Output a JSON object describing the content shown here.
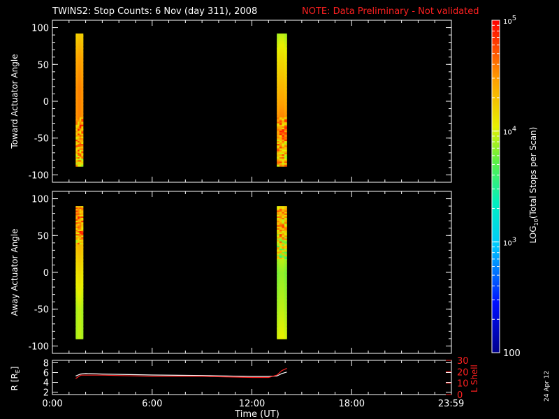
{
  "header": {
    "title": "TWINS2: Stop Counts:  6 Nov (day 311), 2008",
    "note": "NOTE: Data Preliminary - Not validated"
  },
  "footer": {
    "date_stamp": "24 Apr 12"
  },
  "colorbar": {
    "label": "LOG10(Total Stops per Scan)",
    "label_main": "LOG",
    "label_sub": "10",
    "label_rest": "(Total Stops per Scan)",
    "ticks": [
      {
        "value": 100,
        "text": "100"
      },
      {
        "value": 1000,
        "text": "10^3",
        "base": "10",
        "exp": "3"
      },
      {
        "value": 10000,
        "text": "10^4",
        "base": "10",
        "exp": "4"
      },
      {
        "value": 100000,
        "text": "10^5",
        "base": "10",
        "exp": "5"
      }
    ],
    "range": [
      100,
      100000
    ],
    "scale": "log",
    "colormap": "rainbow (blue-cyan-green-yellow-orange-red)"
  },
  "colors": {
    "background": "#000000",
    "axes": "#ffffff",
    "note": "#ff2020",
    "r_line": "#ffffff",
    "l_shell_line": "#ff2020"
  },
  "chart_data": [
    {
      "type": "heatmap",
      "ylabel": "Toward Actuator Angle",
      "xlim": [
        0,
        24
      ],
      "ylim": [
        -110,
        110
      ],
      "yticks": [
        100,
        50,
        0,
        -50,
        -100
      ],
      "yticklabels": [
        "100",
        "50",
        "0",
        "-50",
        "-100"
      ],
      "scan_bands": [
        {
          "start_hour": 1.4,
          "end_hour": 1.85,
          "angle_range": [
            -88,
            92
          ],
          "profile": [
            {
              "angle": 92,
              "log10_counts": 4.2
            },
            {
              "angle": 60,
              "log10_counts": 4.4
            },
            {
              "angle": 20,
              "log10_counts": 4.5
            },
            {
              "angle": 0,
              "log10_counts": 4.5
            },
            {
              "angle": -20,
              "log10_counts": 4.5
            },
            {
              "angle": -50,
              "log10_counts": 4.4,
              "noisy": true
            },
            {
              "angle": -88,
              "log10_counts": 4.3,
              "noisy": true
            }
          ]
        },
        {
          "start_hour": 13.5,
          "end_hour": 14.1,
          "angle_range": [
            -88,
            92
          ],
          "profile": [
            {
              "angle": 92,
              "log10_counts": 3.9
            },
            {
              "angle": 60,
              "log10_counts": 4.1
            },
            {
              "angle": 20,
              "log10_counts": 4.3
            },
            {
              "angle": 0,
              "log10_counts": 4.4
            },
            {
              "angle": -20,
              "log10_counts": 4.5
            },
            {
              "angle": -50,
              "log10_counts": 4.4,
              "noisy": true
            },
            {
              "angle": -88,
              "log10_counts": 4.3,
              "noisy": true
            }
          ]
        }
      ]
    },
    {
      "type": "heatmap",
      "ylabel": "Away Actuator Angle",
      "xlim": [
        0,
        24
      ],
      "ylim": [
        -110,
        110
      ],
      "yticks": [
        100,
        50,
        0,
        -50,
        -100
      ],
      "yticklabels": [
        "100",
        "50",
        "0",
        "-50",
        "-100"
      ],
      "scan_bands": [
        {
          "start_hour": 1.4,
          "end_hour": 1.85,
          "angle_range": [
            -90,
            90
          ],
          "profile": [
            {
              "angle": 90,
              "log10_counts": 4.4,
              "noisy": true
            },
            {
              "angle": 60,
              "log10_counts": 4.5,
              "noisy": true
            },
            {
              "angle": 40,
              "log10_counts": 4.3
            },
            {
              "angle": 0,
              "log10_counts": 4.1
            },
            {
              "angle": -50,
              "log10_counts": 3.9
            },
            {
              "angle": -90,
              "log10_counts": 3.9
            }
          ]
        },
        {
          "start_hour": 13.5,
          "end_hour": 14.1,
          "angle_range": [
            -90,
            90
          ],
          "profile": [
            {
              "angle": 90,
              "log10_counts": 4.4,
              "noisy": true
            },
            {
              "angle": 50,
              "log10_counts": 4.3,
              "noisy": true
            },
            {
              "angle": 20,
              "log10_counts": 3.9
            },
            {
              "angle": 0,
              "log10_counts": 3.8
            },
            {
              "angle": -50,
              "log10_counts": 3.9
            },
            {
              "angle": -90,
              "log10_counts": 4.0
            }
          ]
        }
      ]
    },
    {
      "type": "line",
      "xlabel": "Time (UT)",
      "xlim": [
        0,
        24
      ],
      "xticks": [
        0,
        6,
        12,
        18,
        23.983
      ],
      "xticklabels": [
        "0:00",
        "6:00",
        "12:00",
        "18:00",
        "23:59"
      ],
      "ylabel_left": "R [RE]",
      "ylabel_left_main": "R [R",
      "ylabel_left_sub": "E",
      "ylabel_left_end": "]",
      "ylim_left": [
        1.5,
        8.5
      ],
      "yticks_left": [
        2,
        4,
        6,
        8
      ],
      "ylabel_right": "L Shell",
      "ylim_right": [
        0,
        30
      ],
      "yticks_right": [
        0,
        10,
        20,
        30
      ],
      "series": [
        {
          "axis": "left",
          "x": [
            1.4,
            1.7,
            2.0,
            3.0,
            6.0,
            9.0,
            12.0,
            13.0,
            13.5,
            13.8,
            14.1
          ],
          "y": [
            5.3,
            5.7,
            5.8,
            5.7,
            5.5,
            5.4,
            5.2,
            5.2,
            5.3,
            5.8,
            6.1
          ]
        },
        {
          "axis": "right",
          "x": [
            1.4,
            1.7,
            2.0,
            3.0,
            6.0,
            9.0,
            12.0,
            13.0,
            13.5,
            13.8,
            14.1
          ],
          "y": [
            14,
            17,
            17,
            17,
            16,
            16,
            15,
            15,
            17,
            21,
            23
          ]
        }
      ]
    }
  ]
}
